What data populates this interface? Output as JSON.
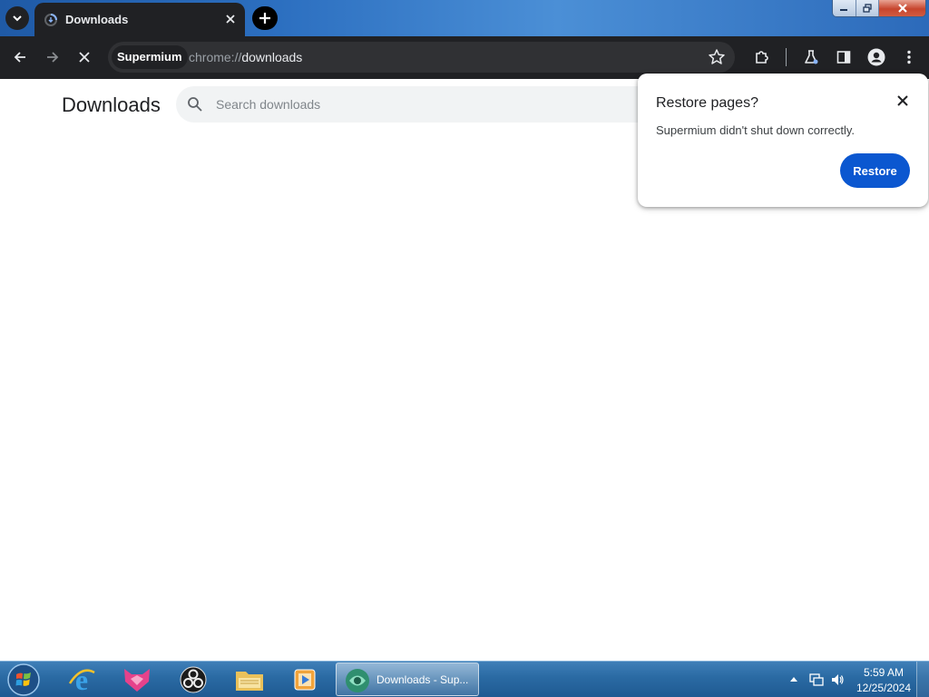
{
  "browser": {
    "tab": {
      "title": "Downloads",
      "icon": "loading-spinner-icon"
    },
    "site_chip": "Supermium",
    "url_scheme": "chrome://",
    "url_path": "downloads"
  },
  "page": {
    "title": "Downloads",
    "search_placeholder": "Search downloads"
  },
  "restore_bubble": {
    "title": "Restore pages?",
    "message": "Supermium didn't shut down correctly.",
    "button_label": "Restore"
  },
  "taskbar": {
    "active_task_label": "Downloads - Sup...",
    "clock_time": "5:59 AM",
    "clock_date": "12/25/2024"
  },
  "colors": {
    "accent_blue": "#0b57d0",
    "toolbar_dark": "#202124",
    "omnibox": "#303134"
  }
}
